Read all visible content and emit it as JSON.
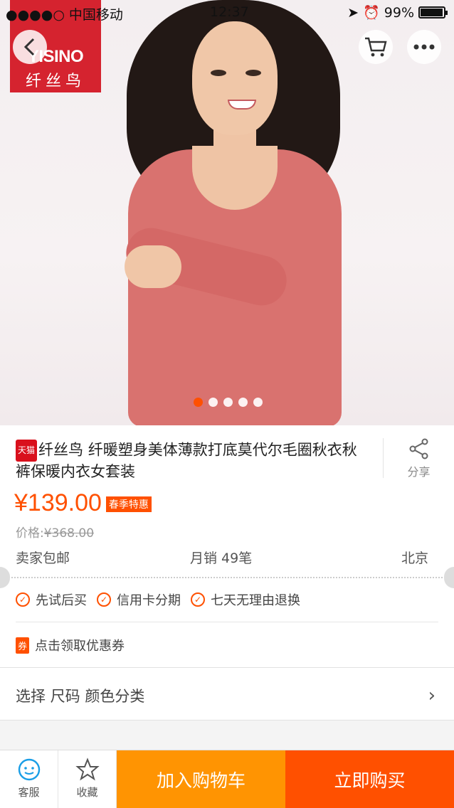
{
  "status_bar": {
    "carrier": "●●●●○ 中国移动",
    "time": "12:37",
    "battery": "99%"
  },
  "brand_logo": {
    "en": "YISINO",
    "cn": "纤丝鸟"
  },
  "gallery": {
    "slide_count": 5,
    "active_index": 0
  },
  "product": {
    "platform_badge": "天猫",
    "title": "纤丝鸟 纤暖塑身美体薄款打底莫代尔毛圈秋衣秋裤保暖内衣女套装",
    "share_label": "分享",
    "price": "¥139.00",
    "promo_tag": "春季特惠",
    "original_price_label": "价格:",
    "original_price": "¥368.00",
    "shipping": "卖家包邮",
    "monthly_sales": "月销 49笔",
    "location": "北京"
  },
  "guarantees": [
    "先试后买",
    "信用卡分期",
    "七天无理由退换"
  ],
  "coupon": {
    "badge": "券",
    "text": "点击领取优惠券"
  },
  "sku_select": {
    "label": "选择 尺码 颜色分类"
  },
  "bottom_bar": {
    "service": "客服",
    "favorite": "收藏",
    "add_to_cart": "加入购物车",
    "buy_now": "立即购买"
  },
  "colors": {
    "accent": "#ff5000",
    "cart_button": "#ff9402",
    "tmall_red": "#d9101c"
  }
}
